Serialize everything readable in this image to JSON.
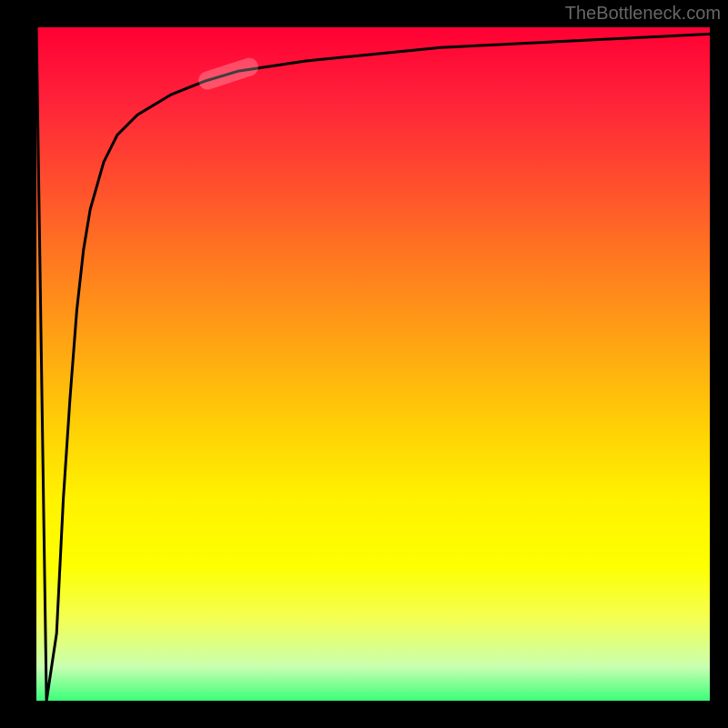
{
  "watermark": "TheBottleneck.com",
  "chart_data": {
    "type": "line",
    "title": "",
    "xlabel": "",
    "ylabel": "",
    "xlim": [
      0,
      100
    ],
    "ylim": [
      0,
      100
    ],
    "grid": false,
    "series": [
      {
        "name": "curve",
        "x": [
          0,
          1.5,
          3,
          4,
          5,
          6,
          7,
          8,
          10,
          12,
          15,
          20,
          25,
          30,
          40,
          50,
          60,
          70,
          80,
          90,
          100
        ],
        "values": [
          100,
          0,
          10,
          30,
          45,
          58,
          67,
          73,
          80,
          84,
          87,
          90,
          92,
          93.5,
          95,
          96,
          97,
          97.5,
          98,
          98.5,
          99
        ]
      }
    ],
    "highlight_range": {
      "x_start": 24,
      "x_end": 33
    },
    "background_gradient": {
      "top": "#ff0033",
      "mid": "#fff200",
      "bottom": "#3bff7a"
    }
  }
}
